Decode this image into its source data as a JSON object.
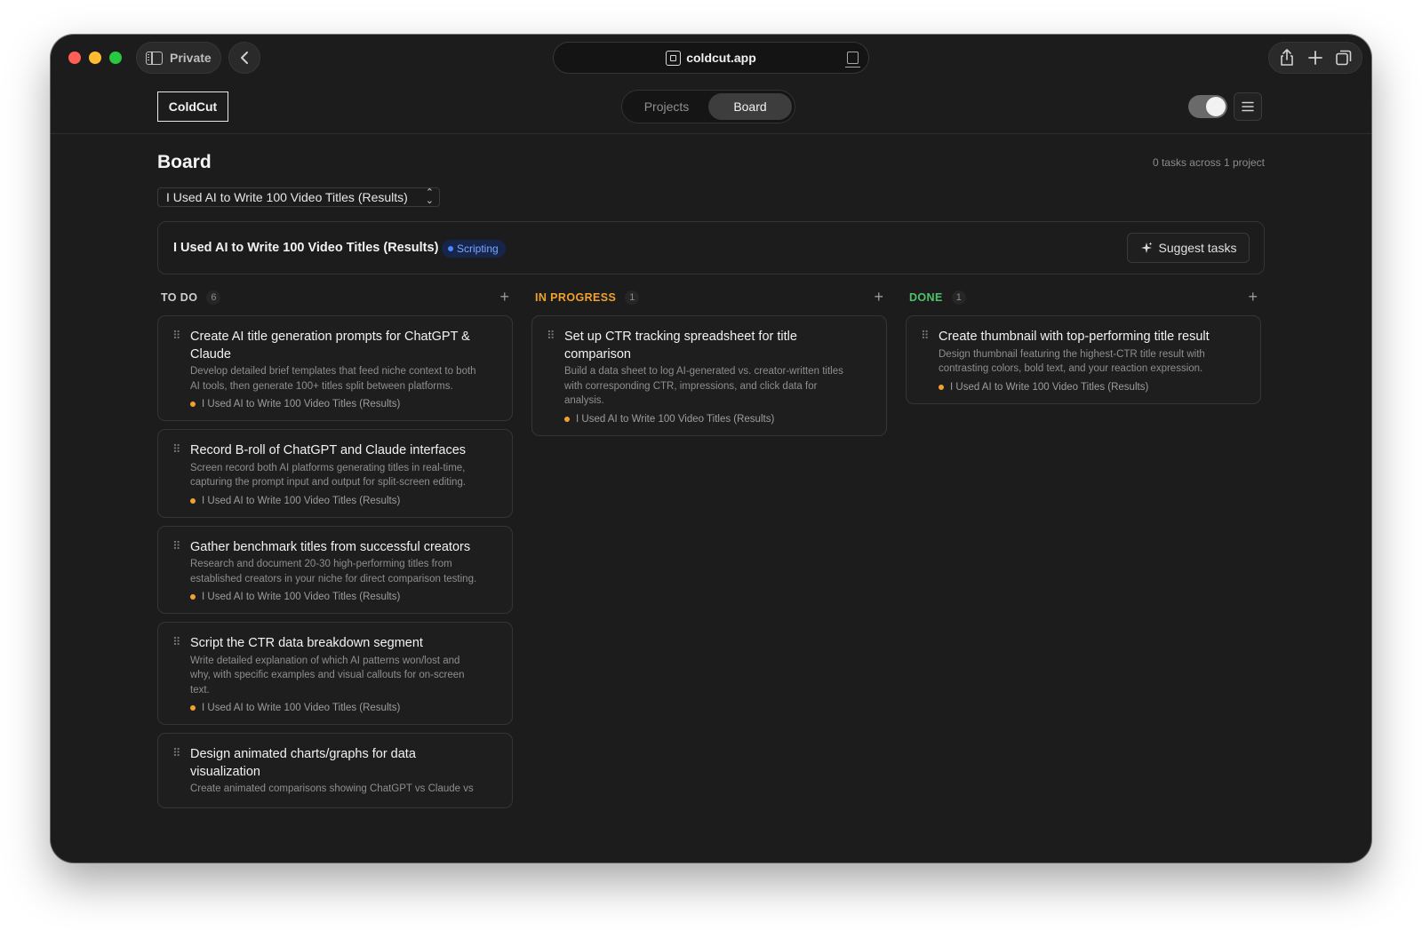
{
  "browser": {
    "private_label": "Private",
    "url": "coldcut.app"
  },
  "app": {
    "logo": "ColdCut",
    "nav_tabs": [
      {
        "label": "Projects",
        "active": false
      },
      {
        "label": "Board",
        "active": true
      }
    ],
    "theme_toggle_on": true
  },
  "board": {
    "title": "Board",
    "task_count_text": "0 tasks across 1 project",
    "project_select_value": "I Used AI to Write 100 Video Titles (Results)",
    "project_bar": {
      "name": "I Used AI to Write 100 Video Titles (Results)",
      "badge": "Scripting",
      "suggest_label": "Suggest tasks"
    },
    "columns": [
      {
        "title": "TO DO",
        "count": "6",
        "color": "#cfcfcf",
        "cards": [
          {
            "title": "Create AI title generation prompts for ChatGPT & Claude",
            "description": "Develop detailed brief templates that feed niche context to both AI tools, then generate 100+ titles split between platforms.",
            "project": "I Used AI to Write 100 Video Titles (Results)"
          },
          {
            "title": "Record B-roll of ChatGPT and Claude interfaces",
            "description": "Screen record both AI platforms generating titles in real-time, capturing the prompt input and output for split-screen editing.",
            "project": "I Used AI to Write 100 Video Titles (Results)"
          },
          {
            "title": "Gather benchmark titles from successful creators",
            "description": "Research and document 20-30 high-performing titles from established creators in your niche for direct comparison testing.",
            "project": "I Used AI to Write 100 Video Titles (Results)"
          },
          {
            "title": "Script the CTR data breakdown segment",
            "description": "Write detailed explanation of which AI patterns won/lost and why, with specific examples and visual callouts for on-screen text.",
            "project": "I Used AI to Write 100 Video Titles (Results)"
          },
          {
            "title": "Design animated charts/graphs for data visualization",
            "description": "Create animated comparisons showing ChatGPT vs Claude vs",
            "project": ""
          }
        ]
      },
      {
        "title": "IN PROGRESS",
        "count": "1",
        "color": "#f0a12e",
        "cards": [
          {
            "title": "Set up CTR tracking spreadsheet for title comparison",
            "description": "Build a data sheet to log AI-generated vs. creator-written titles with corresponding CTR, impressions, and click data for analysis.",
            "project": "I Used AI to Write 100 Video Titles (Results)"
          }
        ]
      },
      {
        "title": "DONE",
        "count": "1",
        "color": "#4cc36a",
        "cards": [
          {
            "title": "Create thumbnail with top-performing title result",
            "description": "Design thumbnail featuring the highest-CTR title result with contrasting colors, bold text, and your reaction expression.",
            "project": "I Used AI to Write 100 Video Titles (Results)"
          }
        ]
      }
    ]
  }
}
